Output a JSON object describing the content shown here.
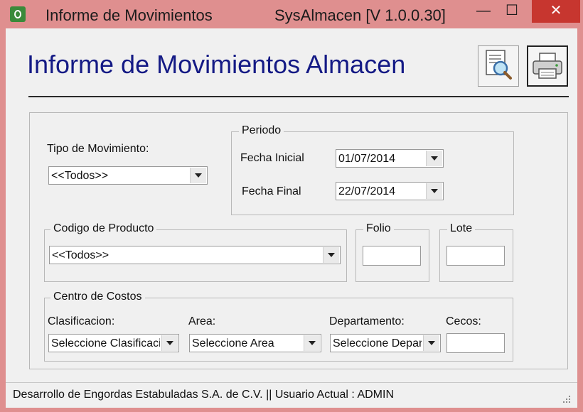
{
  "window": {
    "title": "Informe de Movimientos",
    "version": "SysAlmacen [V 1.0.0.30]",
    "controls": {
      "minimize": "—",
      "maximize": "☐",
      "close": "✕"
    }
  },
  "header": {
    "title": "Informe de Movimientos Almacen",
    "preview_icon": "report-preview-icon",
    "print_icon": "printer-icon"
  },
  "tipo": {
    "label": "Tipo de Movimiento:",
    "value": "<<Todos>>"
  },
  "periodo": {
    "legend": "Periodo",
    "inicial_label": "Fecha Inicial",
    "inicial_value": "01/07/2014",
    "final_label": "Fecha Final",
    "final_value": "22/07/2014"
  },
  "producto": {
    "legend": "Codigo de Producto",
    "value": "<<Todos>>"
  },
  "folio": {
    "legend": "Folio",
    "value": ""
  },
  "lote": {
    "legend": "Lote",
    "value": ""
  },
  "costos": {
    "legend": "Centro de Costos",
    "clasificacion_label": "Clasificacion:",
    "clasificacion_value": "Seleccione Clasificacion",
    "area_label": "Area:",
    "area_value": "Seleccione Area",
    "departamento_label": "Departamento:",
    "departamento_value": "Seleccione Departamento",
    "cecos_label": "Cecos:",
    "cecos_value": ""
  },
  "status": {
    "text": "Desarrollo de Engordas Estabuladas S.A. de C.V.  ||  Usuario Actual : ADMIN"
  },
  "colors": {
    "heading": "#141a85",
    "frame": "#df8f8f",
    "close": "#c7362f"
  }
}
